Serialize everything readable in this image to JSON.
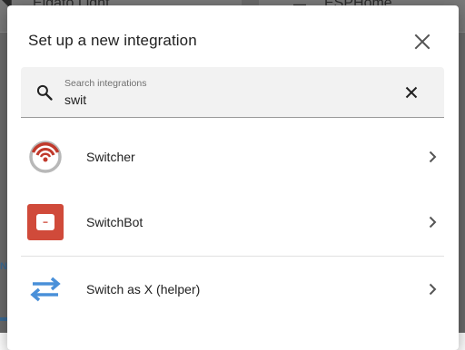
{
  "background": {
    "left_card_title": "Elgato Light",
    "right_card_title": "ESPHome",
    "left_link_fragment": "N"
  },
  "dialog": {
    "title": "Set up a new integration",
    "close_icon": "close-icon"
  },
  "search": {
    "label": "Search integrations",
    "value": "swit",
    "icon": "search-icon",
    "clear_icon": "clear-icon"
  },
  "integrations": [
    {
      "name": "Switcher",
      "icon": "switcher-logo"
    },
    {
      "name": "SwitchBot",
      "icon": "switchbot-logo"
    },
    {
      "name": "Switch as X (helper)",
      "icon": "swap-arrows-icon"
    }
  ],
  "colors": {
    "switcher_red": "#c0392b",
    "switchbot_red": "#d04a3a",
    "helper_blue": "#4a90d9",
    "text_primary": "#212121",
    "search_bg": "#f2f2f2"
  }
}
